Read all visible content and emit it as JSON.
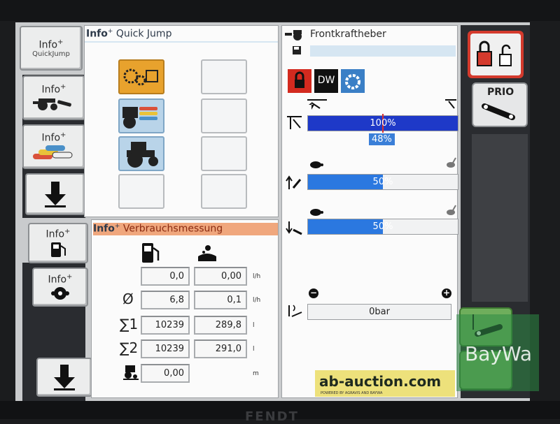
{
  "left_buttons": {
    "quickjump": {
      "label": "Info",
      "sup": "+",
      "sub": "QuickJump"
    },
    "tractor": {
      "label": "Info",
      "sup": "+"
    },
    "hydraulics": {
      "label": "Info",
      "sup": "+"
    },
    "fuel": {
      "label": "Info",
      "sup": "+"
    },
    "hitch": {
      "label": "Info",
      "sup": "+"
    }
  },
  "quick_jump": {
    "title_prefix": "Info",
    "title_sup": "+",
    "title": "Quick Jump"
  },
  "consumption": {
    "title_prefix": "Info",
    "title_sup": "+",
    "title": "Verbrauchsmessung",
    "rows": [
      {
        "label": "",
        "fuel": "0,0",
        "def": "0,00",
        "unit": "l/h"
      },
      {
        "label": "Ø",
        "fuel": "6,8",
        "def": "0,1",
        "unit": "l/h"
      },
      {
        "label": "∑1",
        "fuel": "10239",
        "def": "289,8",
        "unit": "l"
      },
      {
        "label": "∑2",
        "fuel": "10239",
        "def": "291,0",
        "unit": "l"
      }
    ],
    "distance": {
      "value": "0,00",
      "unit": "m"
    }
  },
  "front_hitch": {
    "title": "Frontkraftheber",
    "mode_label": "DW",
    "position_bar": {
      "percent_text": "100%",
      "value": 1.0,
      "actual_text": "48%"
    },
    "lift_speed_bar": {
      "percent_text": "50%",
      "value": 0.5
    },
    "lower_speed_bar": {
      "percent_text": "50%",
      "value": 0.5
    },
    "pressure": {
      "text": "0bar",
      "minus": "−",
      "plus": "+"
    }
  },
  "right_buttons": {
    "prio_label": "PRIO"
  },
  "watermark": {
    "brand": "BayWa",
    "auction": "ab-auction.com",
    "auction_sub": "POWERED BY AGRAVIS AND BAYWA",
    "bezel_brand": "FENDT"
  }
}
